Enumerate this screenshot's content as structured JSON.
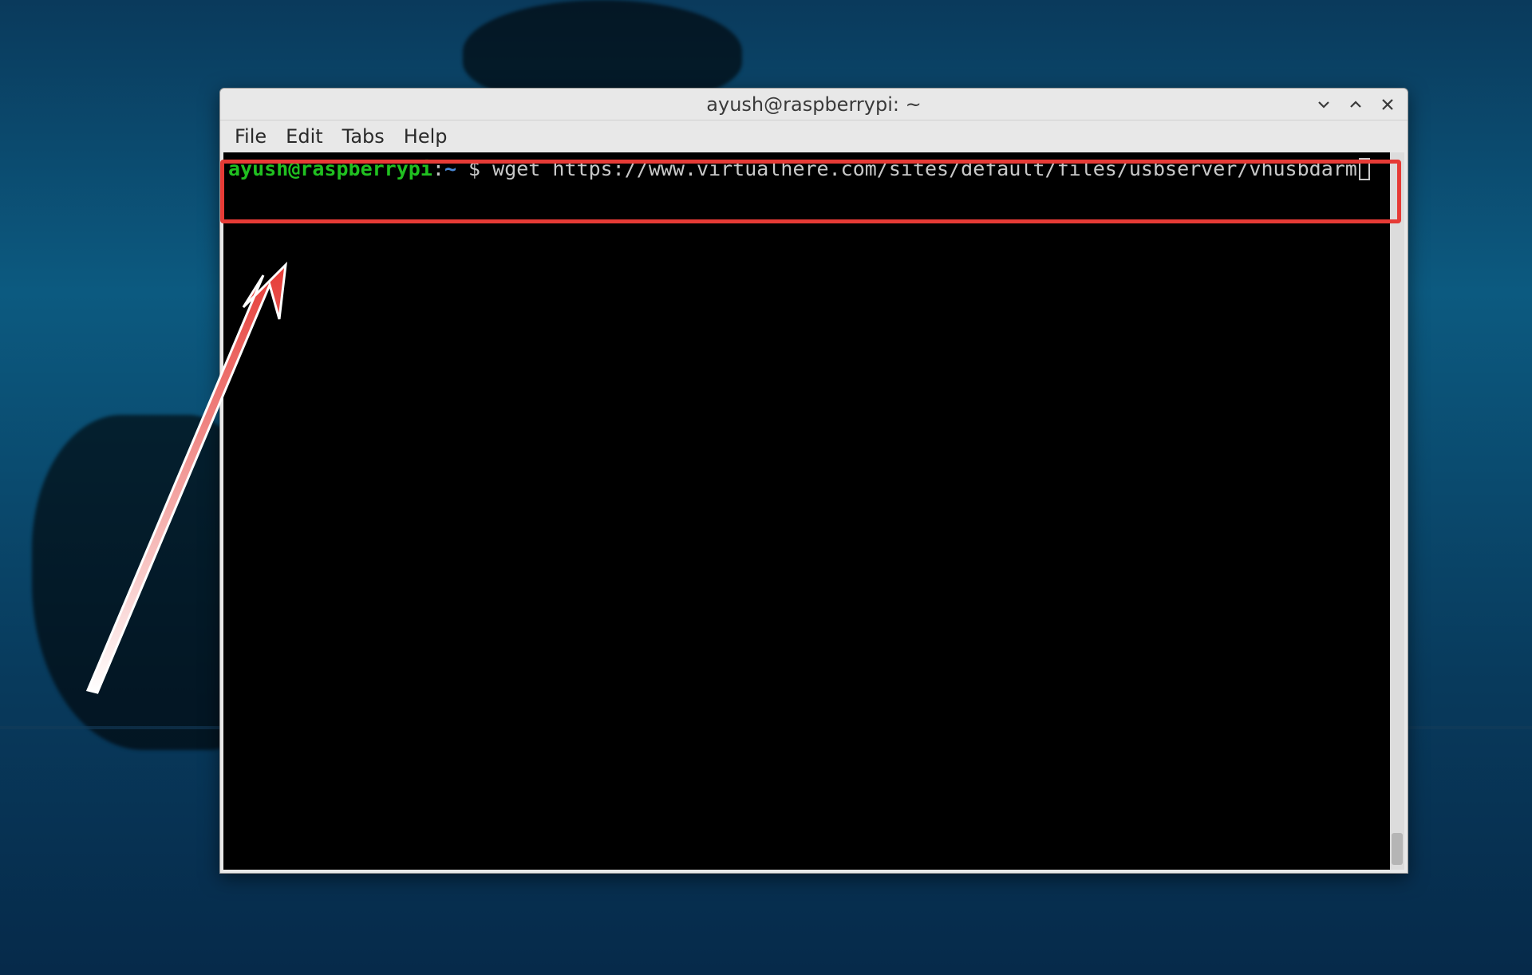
{
  "window": {
    "title": "ayush@raspberrypi: ~"
  },
  "menubar": {
    "file": "File",
    "edit": "Edit",
    "tabs": "Tabs",
    "help": "Help"
  },
  "prompt": {
    "user_host": "ayush@raspberrypi",
    "separator": ":",
    "path": "~",
    "symbol": " $ "
  },
  "command": {
    "text": "wget https://www.virtualhere.com/sites/default/files/usbserver/vhusbdarm"
  },
  "icons": {
    "minimize": "minimize-icon",
    "maximize": "maximize-icon",
    "close": "close-icon"
  }
}
